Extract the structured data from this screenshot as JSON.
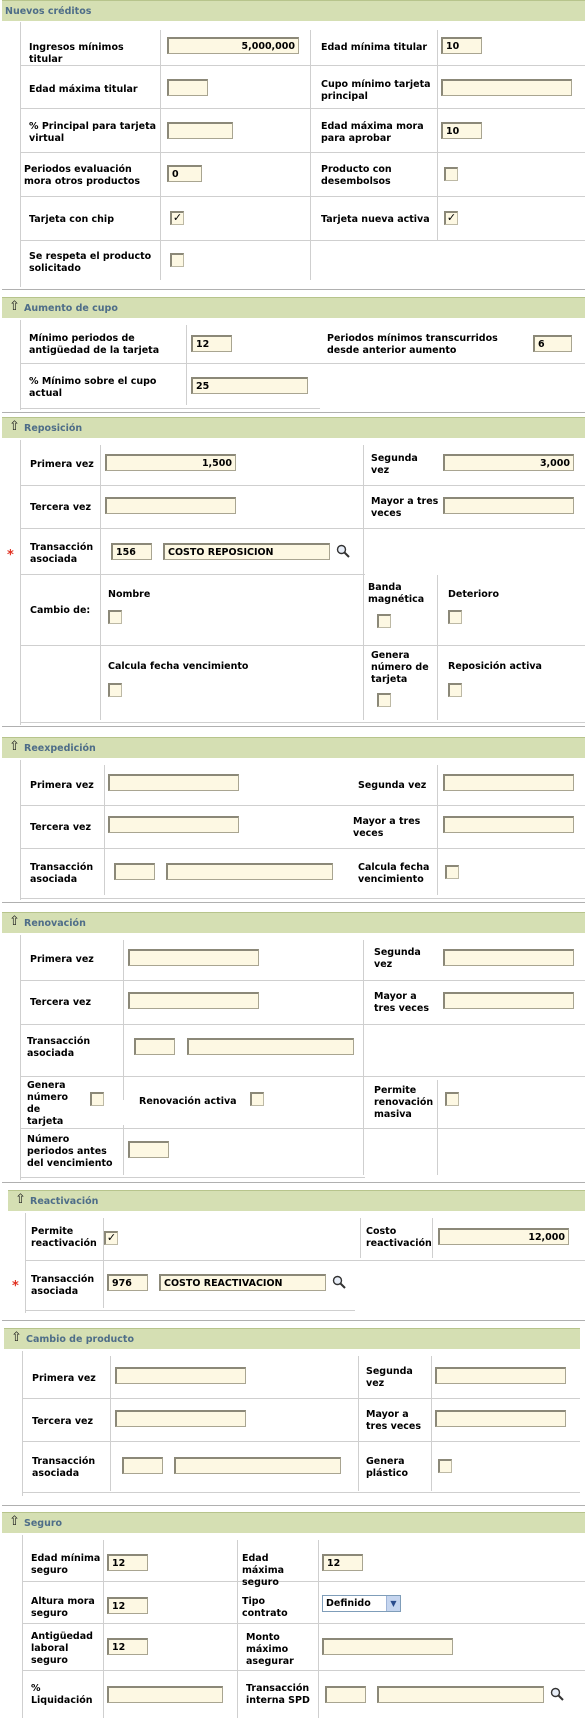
{
  "nuevos": {
    "title": "Nuevos créditos",
    "ingresos_label": "Ingresos mínimos titular",
    "ingresos_value": "5,000,000",
    "edad_min_label": "Edad mínima titular",
    "edad_min_value": "10",
    "edad_max_label": "Edad máxima titular",
    "edad_max_value": "",
    "cupo_min_label": "Cupo mínimo tarjeta principal",
    "cupo_min_value": "",
    "pct_principal_label": "% Principal para tarjeta virtual",
    "pct_principal_value": "",
    "edad_mora_label": "Edad máxima mora para aprobar",
    "edad_mora_value": "10",
    "periodos_eval_label": "Periodos evaluación mora otros productos",
    "periodos_eval_value": "0",
    "desembolsos_label": "Producto con desembolsos",
    "chip_label": "Tarjeta con chip",
    "nueva_activa_label": "Tarjeta nueva activa",
    "respeta_label": "Se respeta el producto solicitado"
  },
  "aumento": {
    "title": "Aumento de cupo",
    "min_periodos_label": "Mínimo periodos de antigüedad de la tarjeta",
    "min_periodos_value": "12",
    "periodos_trans_label": "Periodos mínimos transcurridos desde anterior aumento",
    "periodos_trans_value": "6",
    "pct_min_label": "% Mínimo sobre el cupo actual",
    "pct_min_value": "25"
  },
  "reposicion": {
    "title": "Reposición",
    "primera_label": "Primera vez",
    "primera_value": "1,500",
    "segunda_label": "Segunda vez",
    "segunda_value": "3,000",
    "tercera_label": "Tercera vez",
    "tercera_value": "",
    "mayor_label": "Mayor a tres veces",
    "mayor_value": "",
    "required_mark": "*",
    "trans_label": "Transacción asociada",
    "trans_code": "156",
    "trans_desc": "COSTO REPOSICION",
    "cambio_label": "Cambio de:",
    "nombre_label": "Nombre",
    "banda_label": "Banda magnética",
    "deterioro_label": "Deterioro",
    "calcula_label": "Calcula fecha vencimiento",
    "genera_label": "Genera número de tarjeta",
    "activa_label": "Reposición activa"
  },
  "reexpedicion": {
    "title": "Reexpedición",
    "primera_label": "Primera vez",
    "primera_value": "",
    "segunda_label": "Segunda vez",
    "segunda_value": "",
    "tercera_label": "Tercera vez",
    "tercera_value": "",
    "mayor_label": "Mayor a tres veces",
    "mayor_value": "",
    "trans_label": "Transacción asociada",
    "trans_code": "",
    "trans_desc": "",
    "calcula_label": "Calcula fecha vencimiento"
  },
  "renovacion": {
    "title": "Renovación",
    "primera_label": "Primera vez",
    "primera_value": "",
    "segunda_label": "Segunda vez",
    "segunda_value": "",
    "tercera_label": "Tercera vez",
    "tercera_value": "",
    "mayor_label": "Mayor a tres veces",
    "mayor_value": "",
    "trans_label": "Transacción asociada",
    "trans_code": "",
    "trans_desc": "",
    "genera_label": "Genera número de tarjeta",
    "activa_label": "Renovación activa",
    "masiva_label": "Permite renovación masiva",
    "num_periodos_label": "Número periodos antes del vencimiento",
    "num_periodos_value": ""
  },
  "reactivacion": {
    "title": "Reactivación",
    "permite_label": "Permite reactivación",
    "costo_label": "Costo reactivación",
    "costo_value": "12,000",
    "required_mark": "*",
    "trans_label": "Transacción asociada",
    "trans_code": "976",
    "trans_desc": "COSTO REACTIVACION"
  },
  "cambio": {
    "title": "Cambio de producto",
    "primera_label": "Primera vez",
    "primera_value": "",
    "segunda_label": "Segunda vez",
    "segunda_value": "",
    "tercera_label": "Tercera vez",
    "tercera_value": "",
    "mayor_label": "Mayor a tres veces",
    "mayor_value": "",
    "trans_label": "Transacción asociada",
    "trans_code": "",
    "trans_desc": "",
    "plastico_label": "Genera plástico"
  },
  "seguro": {
    "title": "Seguro",
    "edad_min_label": "Edad mínima seguro",
    "edad_min_value": "12",
    "edad_max_label": "Edad máxima seguro",
    "edad_max_value": "12",
    "altura_label": "Altura mora seguro",
    "altura_value": "12",
    "tipo_label": "Tipo contrato",
    "tipo_value": "Definido",
    "antig_label": "Antigüedad laboral seguro",
    "antig_value": "12",
    "monto_label": "Monto máximo asegurar",
    "monto_value": "",
    "liquid_label": "% Liquidación",
    "liquid_value": "",
    "trans_label": "Transacción interna SPD",
    "trans_code": "",
    "trans_desc": ""
  },
  "icons": {
    "section_toggle": "arrow-up-icon",
    "lookup": "magnifier-icon"
  },
  "colors": {
    "header_bg": "#d5dfb3",
    "header_text": "#4e6d88",
    "input_bg": "#fdf8e3",
    "required": "#e03020"
  }
}
